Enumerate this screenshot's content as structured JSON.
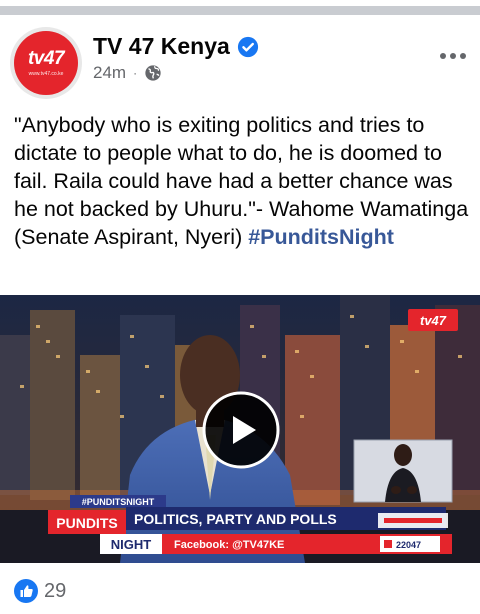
{
  "page": {
    "name": "TV 47 Kenya",
    "avatar_logo": "tv47",
    "avatar_sub": "www.tv47.co.ke",
    "timestamp": "24m",
    "separator": "·"
  },
  "post": {
    "text": "\"Anybody who is exiting politics and tries to dictate to people what to do, he is doomed to fail. Raila could have had a better chance was he not backed by Uhuru.\"- Wahome Wamatinga (Senate Aspirant, Nyeri) ",
    "hashtag": "#PunditsNight"
  },
  "video": {
    "channel_bug": "tv47",
    "hashtag_tag": "#PUNDITSNIGHT",
    "show_top": "PUNDITS",
    "show_bottom": "NIGHT",
    "headline": "POLITICS, PARTY AND POLLS",
    "social": "Facebook: @TV47KE",
    "sms": "22047"
  },
  "reactions": {
    "count": "29"
  },
  "colors": {
    "brand_red": "#e4252c",
    "link_blue": "#385898",
    "verified_blue": "#1877f2",
    "meta_gray": "#65676b"
  }
}
